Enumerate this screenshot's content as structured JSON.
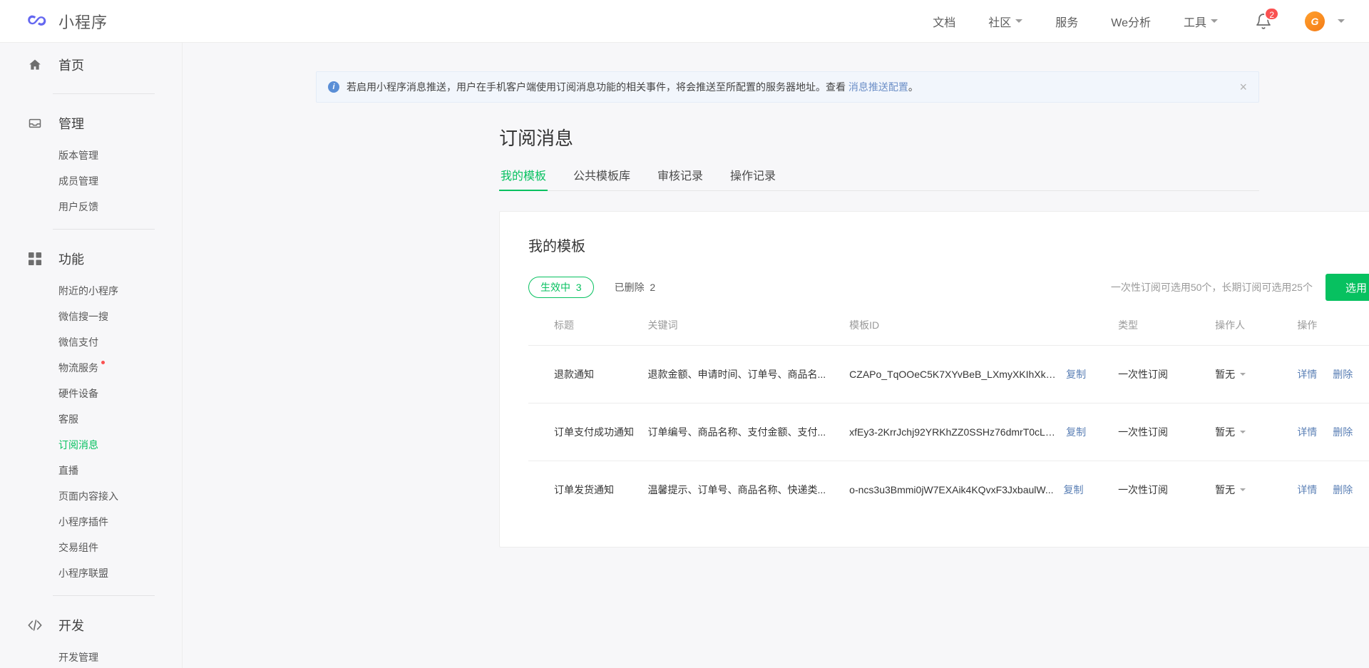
{
  "header": {
    "brand": "小程序",
    "logo_icon": "miniprogram-logo-icon",
    "nav": [
      {
        "label": "文档",
        "has_caret": false
      },
      {
        "label": "社区",
        "has_caret": true
      },
      {
        "label": "服务",
        "has_caret": false
      },
      {
        "label": "We分析",
        "has_caret": false
      },
      {
        "label": "工具",
        "has_caret": true
      }
    ],
    "bell_icon": "bell-icon",
    "notification_count": "2",
    "avatar_letter": "G",
    "accent_color": "#07c160",
    "badge_color": "#fa5151"
  },
  "sidebar": {
    "groups": [
      {
        "icon": "home-icon",
        "label": "首页",
        "items": []
      },
      {
        "icon": "inbox-icon",
        "label": "管理",
        "items": [
          {
            "label": "版本管理",
            "active": false,
            "dot": false
          },
          {
            "label": "成员管理",
            "active": false,
            "dot": false
          },
          {
            "label": "用户反馈",
            "active": false,
            "dot": false
          }
        ]
      },
      {
        "icon": "grid-icon",
        "label": "功能",
        "items": [
          {
            "label": "附近的小程序",
            "active": false,
            "dot": false
          },
          {
            "label": "微信搜一搜",
            "active": false,
            "dot": false
          },
          {
            "label": "微信支付",
            "active": false,
            "dot": false
          },
          {
            "label": "物流服务",
            "active": false,
            "dot": true
          },
          {
            "label": "硬件设备",
            "active": false,
            "dot": false
          },
          {
            "label": "客服",
            "active": false,
            "dot": false
          },
          {
            "label": "订阅消息",
            "active": true,
            "dot": false
          },
          {
            "label": "直播",
            "active": false,
            "dot": false
          },
          {
            "label": "页面内容接入",
            "active": false,
            "dot": false
          },
          {
            "label": "小程序插件",
            "active": false,
            "dot": false
          },
          {
            "label": "交易组件",
            "active": false,
            "dot": false
          },
          {
            "label": "小程序联盟",
            "active": false,
            "dot": false
          }
        ]
      },
      {
        "icon": "code-icon",
        "label": "开发",
        "items": [
          {
            "label": "开发管理",
            "active": false,
            "dot": false
          }
        ]
      }
    ]
  },
  "banner": {
    "icon": "info-icon",
    "text_before": "若启用小程序消息推送，用户在手机客户端使用订阅消息功能的相关事件，将会推送至所配置的服务器地址。查看 ",
    "link": "消息推送配置",
    "text_after": "。",
    "close_icon": "close-icon"
  },
  "page": {
    "title": "订阅消息",
    "tabs": [
      {
        "label": "我的模板",
        "active": true
      },
      {
        "label": "公共模板库",
        "active": false
      },
      {
        "label": "审核记录",
        "active": false
      },
      {
        "label": "操作记录",
        "active": false
      }
    ]
  },
  "card": {
    "title": "我的模板",
    "chips": [
      {
        "label": "生效中",
        "count": "3",
        "active": true
      },
      {
        "label": "已删除",
        "count": "2",
        "active": false
      }
    ],
    "quota_text": "一次性订阅可选用50个，长期订阅可选用25个",
    "select_button": "选用"
  },
  "table": {
    "columns": [
      "标题",
      "关键词",
      "模板ID",
      "类型",
      "操作人",
      "操作"
    ],
    "copy_label": "复制",
    "detail_label": "详情",
    "delete_label": "删除",
    "rows": [
      {
        "title": "退款通知",
        "keywords": "退款金额、申请时间、订单号、商品名...",
        "template_id": "CZAPo_TqOOeC5K7XYvBeB_LXmyXKIhXkZ...",
        "type": "一次性订阅",
        "operator": "暂无"
      },
      {
        "title": "订单支付成功通知",
        "keywords": "订单编号、商品名称、支付金额、支付...",
        "template_id": "xfEy3-2KrrJchj92YRKhZZ0SSHz76dmrT0cLB...",
        "type": "一次性订阅",
        "operator": "暂无"
      },
      {
        "title": "订单发货通知",
        "keywords": "温馨提示、订单号、商品名称、快递类...",
        "template_id": "o-ncs3u3Bmmi0jW7EXAik4KQvxF3JxbaulW...",
        "type": "一次性订阅",
        "operator": "暂无"
      }
    ]
  }
}
